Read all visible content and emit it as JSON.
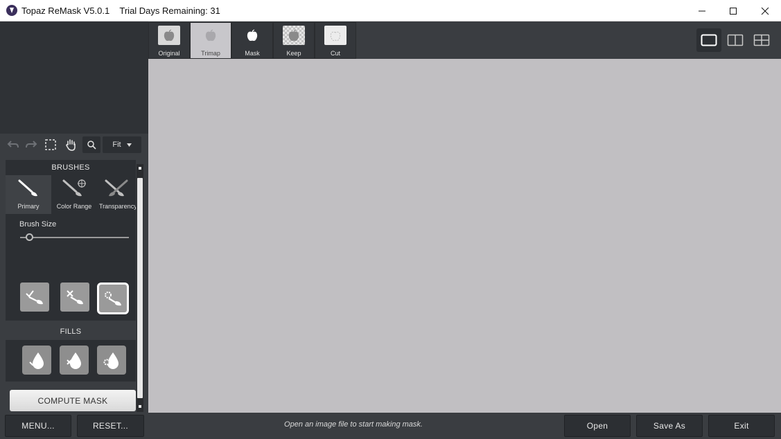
{
  "window": {
    "title": "Topaz ReMask V5.0.1    Trial Days Remaining: 31"
  },
  "view_tabs": [
    {
      "label": "Original",
      "icon": "apple-icon"
    },
    {
      "label": "Trimap",
      "icon": "apple-icon"
    },
    {
      "label": "Mask",
      "icon": "apple-icon"
    },
    {
      "label": "Keep",
      "icon": "apple-icon"
    },
    {
      "label": "Cut",
      "icon": "apple-icon"
    }
  ],
  "active_view": "Trimap",
  "toolbar": {
    "zoom_value": "Fit"
  },
  "brushes": {
    "title": "BRUSHES",
    "tabs": [
      {
        "label": "Primary"
      },
      {
        "label": "Color Range"
      },
      {
        "label": "Transparency"
      }
    ],
    "brush_size_label": "Brush Size",
    "brush_size_value": 0.08
  },
  "fills": {
    "title": "FILLS"
  },
  "compute_label": "COMPUTE MASK",
  "bottom": {
    "menu_label": "MENU...",
    "reset_label": "RESET...",
    "status": "Open an image file to start making mask.",
    "open_label": "Open",
    "save_as_label": "Save As",
    "exit_label": "Exit"
  },
  "colors": {
    "panel": "#3a3d41",
    "canvas": "#c1bfc2",
    "accent_white": "#ffffff"
  }
}
